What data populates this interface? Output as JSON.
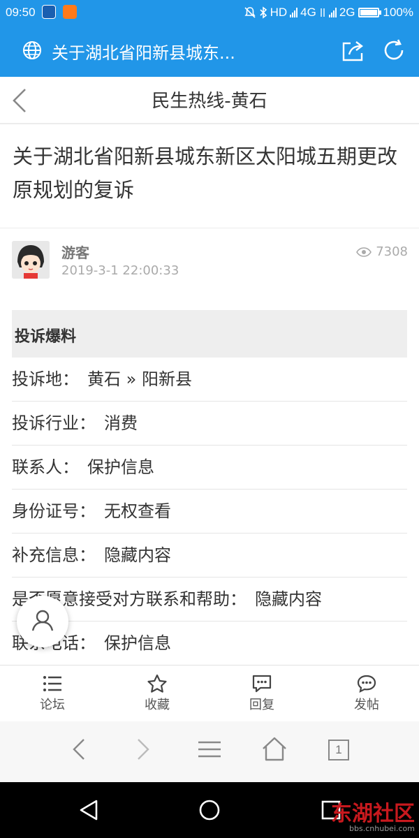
{
  "status_bar": {
    "time": "09:50",
    "hd": "HD",
    "net1": "4G",
    "net2": "2G",
    "battery_percent": "100%",
    "battery_level": 1.0
  },
  "browser": {
    "page_title": "关于湖北省阳新县城东..."
  },
  "header": {
    "title": "民生热线-黄石"
  },
  "article": {
    "title": "关于湖北省阳新县城东新区太阳城五期更改原规划的复诉",
    "author": "游客",
    "date": "2019-3-1 22:00:33",
    "views": "7308"
  },
  "section": {
    "title": "投诉爆料"
  },
  "fields": [
    {
      "label": "投诉地：",
      "value": "黄石 » 阳新县"
    },
    {
      "label": "投诉行业：",
      "value": "消费"
    },
    {
      "label": "联系人：",
      "value": "保护信息"
    },
    {
      "label": "身份证号：",
      "value": "无权查看"
    },
    {
      "label": "补充信息：",
      "value": "隐藏内容"
    },
    {
      "label": "是否愿意接受对方联系和帮助：",
      "value": "隐藏内容"
    },
    {
      "label": "联系电话：",
      "value": "保护信息"
    }
  ],
  "toolbar": {
    "forum": "论坛",
    "favorite": "收藏",
    "reply": "回复",
    "post": "发帖"
  },
  "browser_nav": {
    "tab_count": "1"
  },
  "watermark": {
    "brand": "东湖社区",
    "url": "bbs.cnhubei.com"
  },
  "colors": {
    "brand_blue": "#2196e8",
    "watermark_red": "#c8191e"
  }
}
